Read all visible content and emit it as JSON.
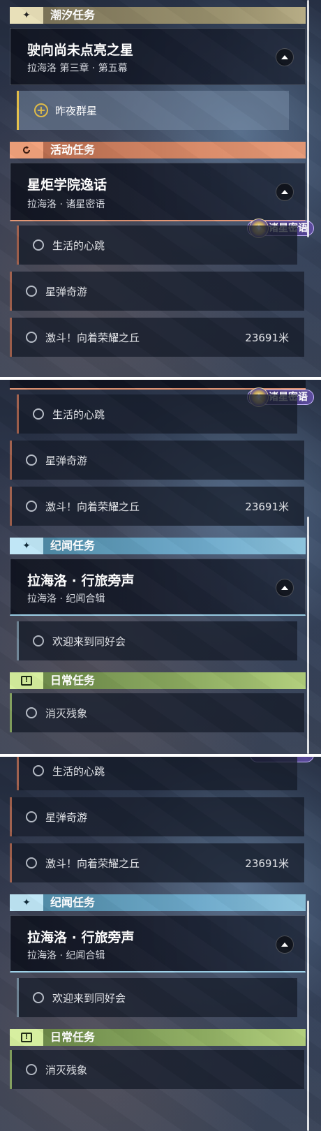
{
  "shot1": {
    "tide_header": {
      "icon": "✦",
      "title": "潮汐任务"
    },
    "tide_card": {
      "title": "驶向尚未点亮之星",
      "subtitle": "拉海洛 第三章 · 第五幕"
    },
    "tide_active_sub": {
      "icon": "+",
      "label": "昨夜群星"
    },
    "event_header": {
      "title": "活动任务"
    },
    "event_card": {
      "title": "星炬学院逸话",
      "subtitle": "拉海洛 · 诸星密语"
    },
    "badge": {
      "icon": "✦",
      "label": "诸星密语"
    },
    "subs": [
      {
        "label": "生活的心跳"
      },
      {
        "label": "星弹奇游"
      },
      {
        "label": "激斗！向着荣耀之丘",
        "distance": "23691米"
      }
    ]
  },
  "shot2": {
    "badge": {
      "icon": "✦",
      "label": "诸星密语"
    },
    "subs": [
      {
        "label": "生活的心跳"
      },
      {
        "label": "星弹奇游"
      },
      {
        "label": "激斗！向着荣耀之丘",
        "distance": "23691米"
      }
    ],
    "lore_header": {
      "icon": "✦",
      "title": "纪闻任务"
    },
    "lore_card": {
      "title": "拉海洛 · 行旅旁声",
      "subtitle": "拉海洛 · 纪闻合辑"
    },
    "lore_sub": {
      "label": "欢迎来到同好会"
    },
    "daily_header": {
      "icon": "!",
      "title": "日常任务"
    },
    "daily_sub": {
      "label": "消灭残象"
    }
  },
  "shot3": {
    "subs": [
      {
        "label": "生活的心跳"
      },
      {
        "label": "星弹奇游"
      },
      {
        "label": "激斗！向着荣耀之丘",
        "distance": "23691米"
      }
    ],
    "lore_header": {
      "icon": "✦",
      "title": "纪闻任务"
    },
    "lore_card": {
      "title": "拉海洛 · 行旅旁声",
      "subtitle": "拉海洛 · 纪闻合辑"
    },
    "lore_sub": {
      "label": "欢迎来到同好会"
    },
    "daily_header": {
      "icon": "!",
      "title": "日常任务"
    },
    "daily_sub": {
      "label": "消灭残象"
    }
  }
}
